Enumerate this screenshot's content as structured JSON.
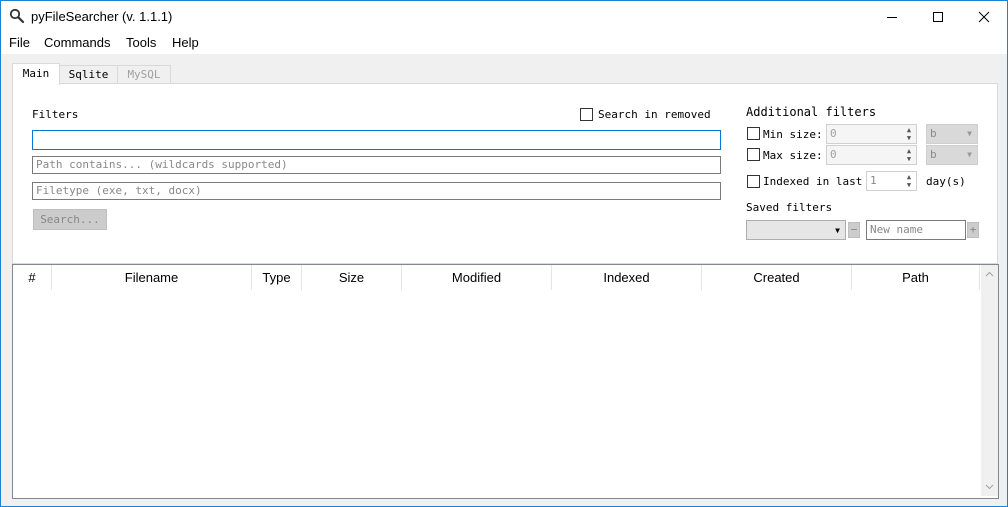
{
  "window": {
    "title": "pyFileSearcher (v. 1.1.1)",
    "accent": "#1883d7"
  },
  "menu": [
    "File",
    "Commands",
    "Tools",
    "Help"
  ],
  "tabs": [
    {
      "label": "Main",
      "state": "active"
    },
    {
      "label": "Sqlite",
      "state": "normal"
    },
    {
      "label": "MySQL",
      "state": "disabled"
    }
  ],
  "filters": {
    "heading": "Filters",
    "search_in_removed": "Search in removed",
    "search_in_removed_checked": false,
    "name_value": "",
    "path_placeholder": "Path contains... (wildcards supported)",
    "filetype_placeholder": "Filetype (exe, txt, docx)",
    "search_button": "Search..."
  },
  "additional": {
    "heading": "Additional filters",
    "min_size_label": "Min size:",
    "min_size_value": "0",
    "min_size_unit": "b",
    "max_size_label": "Max size:",
    "max_size_value": "0",
    "max_size_unit": "b",
    "indexed_label": "Indexed in last",
    "indexed_value": "1",
    "indexed_unit": "day(s)",
    "saved_heading": "Saved filters",
    "minus": "−",
    "new_name_placeholder": "New name",
    "plus": "+"
  },
  "table": {
    "columns": [
      "#",
      "Filename",
      "Type",
      "Size",
      "Modified",
      "Indexed",
      "Created",
      "Path"
    ]
  }
}
